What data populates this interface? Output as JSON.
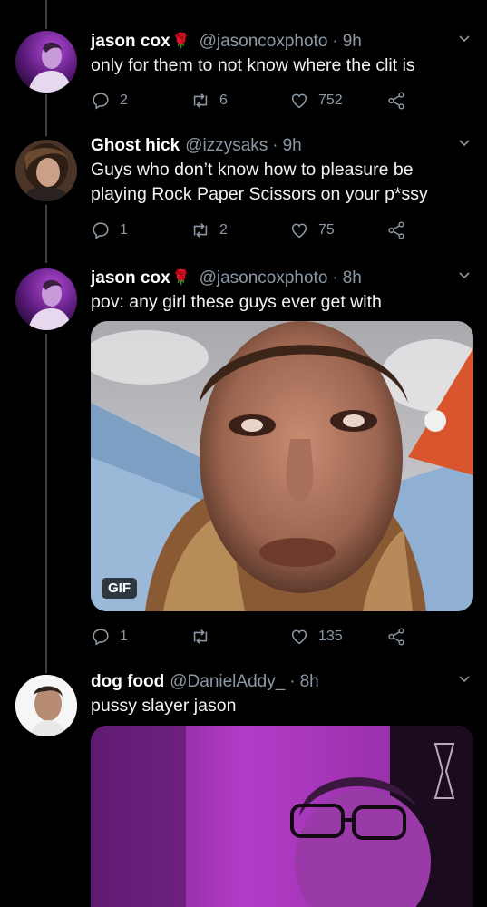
{
  "tweets": [
    {
      "name": "jason cox",
      "emoji": "🌹",
      "handle": "@jasoncoxphoto",
      "time": "9h",
      "text": "only for them to not know where the clit is",
      "replies": "2",
      "retweets": "6",
      "likes": "752"
    },
    {
      "name": "Ghost hick",
      "handle": "@izzysaks",
      "time": "9h",
      "text": "Guys who don’t know how to pleasure be playing Rock Paper Scissors on your p*ssy",
      "replies": "1",
      "retweets": "2",
      "likes": "75"
    },
    {
      "name": "jason cox",
      "emoji": "🌹",
      "handle": "@jasoncoxphoto",
      "time": "8h",
      "text": "pov: any girl these guys ever get with",
      "gif_label": "GIF",
      "replies": "1",
      "retweets": "",
      "likes": "135"
    },
    {
      "name": "dog food",
      "handle": "@DanielAddy_",
      "time": "8h",
      "text": "pussy slayer jason"
    }
  ],
  "separator": "·",
  "colors": {
    "background": "#000000",
    "secondary_text": "#8b98a5",
    "thread_line": "#3d4144"
  }
}
